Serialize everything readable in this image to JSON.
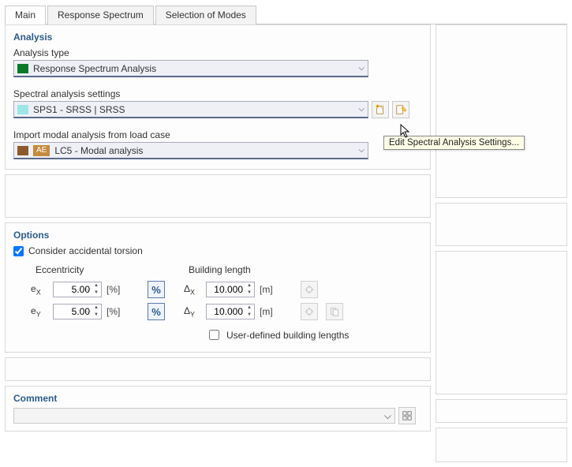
{
  "tabs": {
    "main": "Main",
    "response_spectrum": "Response Spectrum",
    "selection_of_modes": "Selection of Modes"
  },
  "analysis": {
    "title": "Analysis",
    "type_label": "Analysis type",
    "type_value": "Response Spectrum Analysis",
    "spectral_label": "Spectral analysis settings",
    "spectral_value": "SPS1 - SRSS | SRSS",
    "import_label": "Import modal analysis from load case",
    "import_tag": "AE",
    "import_value": "LC5 - Modal analysis"
  },
  "tooltip": "Edit Spectral Analysis Settings...",
  "options": {
    "title": "Options",
    "accidental_torsion": "Consider accidental torsion",
    "accidental_torsion_checked": true,
    "eccentricity_header": "Eccentricity",
    "ex_label": "eX",
    "ey_label": "eY",
    "ex_value": "5.00",
    "ey_value": "5.00",
    "pct_unit": "[%]",
    "pct_symbol": "%",
    "building_header": "Building length",
    "dx_label": "ΔX",
    "dy_label": "ΔY",
    "dx_value": "10.000",
    "dy_value": "10.000",
    "m_unit": "[m]",
    "userdef_label": "User-defined building lengths",
    "userdef_checked": false
  },
  "comment": {
    "title": "Comment",
    "value": ""
  }
}
